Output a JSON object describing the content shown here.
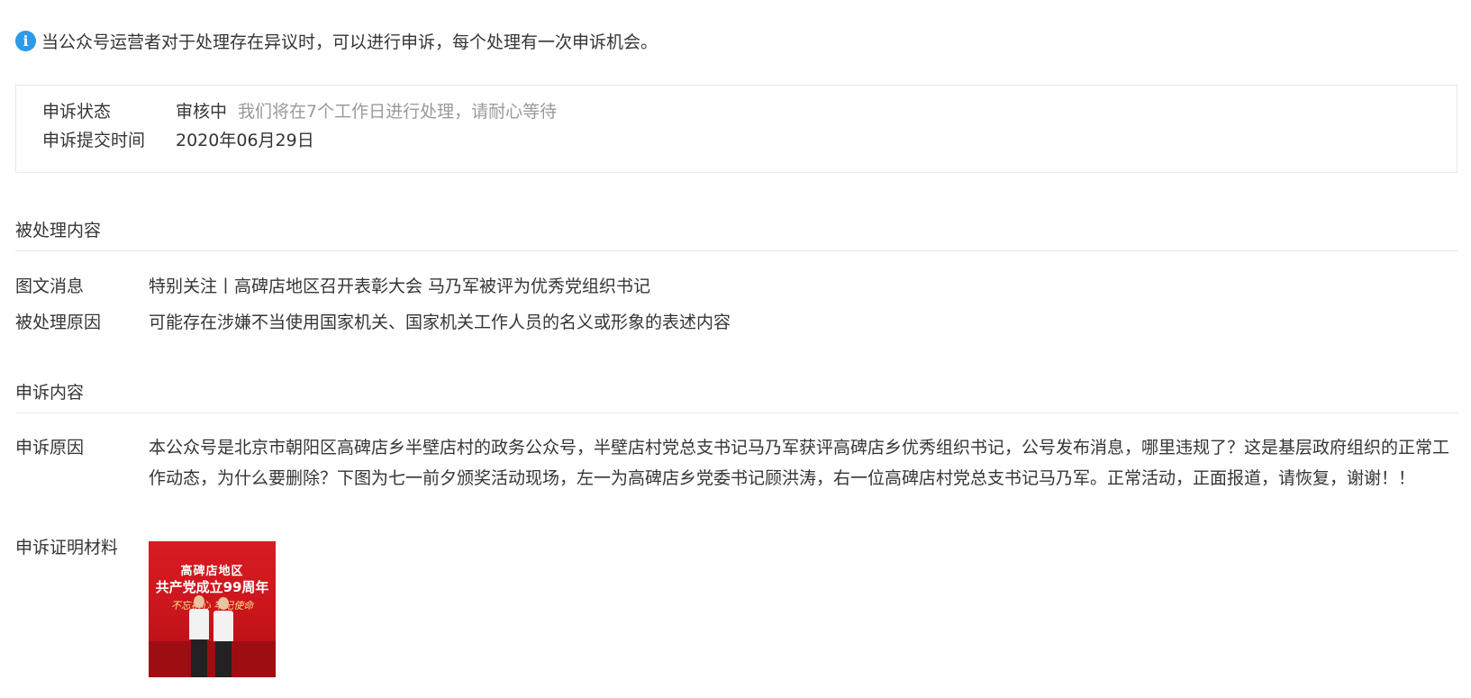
{
  "notice": {
    "icon": "info-icon",
    "text": "当公众号运营者对于处理存在异议时，可以进行申诉，每个处理有一次申诉机会。"
  },
  "appeal_status": {
    "status_label": "申诉状态",
    "status_value": "审核中",
    "status_hint": "我们将在7个工作日进行处理，请耐心等待",
    "submit_time_label": "申诉提交时间",
    "submit_time_value": "2020年06月29日"
  },
  "processed_content": {
    "section_title": "被处理内容",
    "article_label": "图文消息",
    "article_value": "特别关注丨高碑店地区召开表彰大会 马乃军被评为优秀党组织书记",
    "reason_label": "被处理原因",
    "reason_value": "可能存在涉嫌不当使用国家机关、国家机关工作人员的名义或形象的表述内容"
  },
  "appeal_content": {
    "section_title": "申诉内容",
    "reason_label": "申诉原因",
    "reason_value": "本公众号是北京市朝阳区高碑店乡半壁店村的政务公众号，半壁店村党总支书记马乃军获评高碑店乡优秀组织书记，公号发布消息，哪里违规了？这是基层政府组织的正常工作动态，为什么要删除？下图为七一前夕颁奖活动现场，左一为高碑店乡党委书记顾洪涛，右一位高碑店村党总支书记马乃军。正常活动，正面报道，请恢复，谢谢！！",
    "proof_label": "申诉证明材料",
    "proof_image": {
      "line1": "高碑店地区",
      "line2": "共产党成立99周年",
      "line3": "不忘初心 牢记使命"
    }
  },
  "colors": {
    "text": "#353535",
    "hint": "#9a9a9a",
    "border": "#e4e8eb",
    "info_icon": "#2c9ae8",
    "poster_red": "#d81c22"
  }
}
